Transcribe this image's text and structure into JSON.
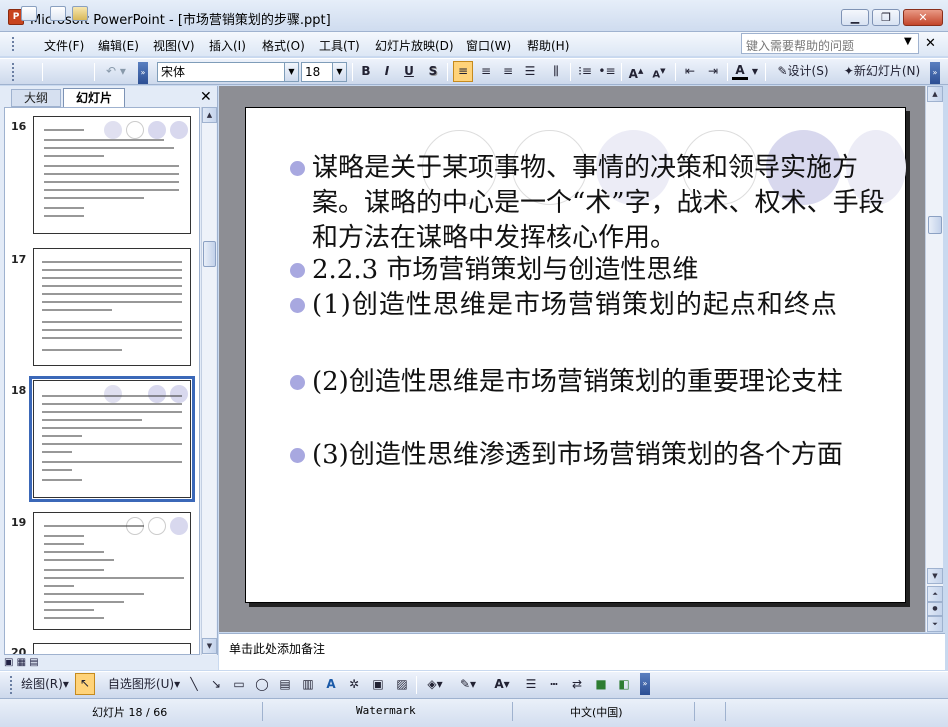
{
  "window": {
    "title": "Microsoft PowerPoint - [市场营销策划的步骤.ppt]",
    "app_icon": "P",
    "minimize": "▁",
    "restore": "❐",
    "close": "✕"
  },
  "menu": {
    "items": [
      "文件(F)",
      "编辑(E)",
      "视图(V)",
      "插入(I)",
      "格式(O)",
      "工具(T)",
      "幻灯片放映(D)",
      "窗口(W)",
      "帮助(H)"
    ],
    "help_placeholder": "键入需要帮助的问题",
    "doc_close": "✕"
  },
  "toolbar": {
    "font_name": "宋体",
    "font_size": "18",
    "bold": "B",
    "italic": "I",
    "underline": "U",
    "shadow": "S",
    "font_color": "A",
    "grow": "A",
    "shrink": "A",
    "design_label": "设计(S)",
    "new_slide_label": "新幻灯片(N)"
  },
  "left_panel": {
    "tab_outline": "大纲",
    "tab_slides": "幻灯片",
    "close": "✕",
    "view_icons": "▣ ▦ ▤",
    "thumbnails": [
      {
        "number": "16",
        "selected": false
      },
      {
        "number": "17",
        "selected": false
      },
      {
        "number": "18",
        "selected": true
      },
      {
        "number": "19",
        "selected": false
      },
      {
        "number": "20",
        "selected": false
      }
    ]
  },
  "slide": {
    "bullets": [
      "谋略是关于某项事物、事情的决策和领导实施方案。谋略的中心是一个“术”字，战术、权术、手段和方法在谋略中发挥核心作用。",
      "2.2.3  市场营销策划与创造性思维",
      "(1)创造性思维是市场营销策划的起点和终点",
      "(2)创造性思维是市场营销策划的重要理论支柱",
      "(3)创造性思维渗透到市场营销策划的各个方面"
    ],
    "bullet_color": "#a8a8e0",
    "circle_color": "#d6d6ee"
  },
  "notes": {
    "placeholder": "单击此处添加备注"
  },
  "drawing": {
    "draw_label": "绘图(R)",
    "autoshape_label": "自选图形(U)"
  },
  "status": {
    "slide_info": "幻灯片 18 / 66",
    "template": "Watermark",
    "language": "中文(中国)"
  }
}
